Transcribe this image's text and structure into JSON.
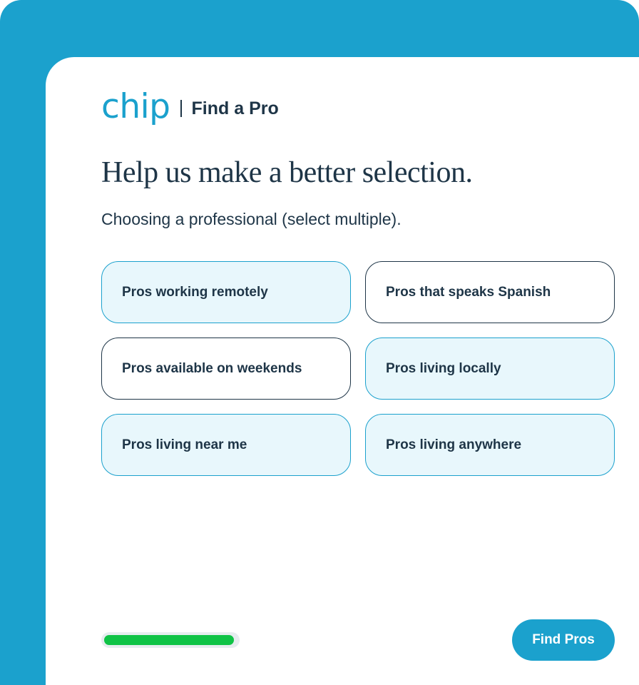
{
  "brand": {
    "logo_text": "chip",
    "title": "Find a Pro"
  },
  "question": {
    "heading": "Help us make a better selection.",
    "subheading": "Choosing a professional (select multiple)."
  },
  "options": [
    {
      "label": "Pros working remotely",
      "selected": true
    },
    {
      "label": "Pros that speaks Spanish",
      "selected": false
    },
    {
      "label": "Pros available on weekends",
      "selected": false
    },
    {
      "label": "Pros living locally",
      "selected": true
    },
    {
      "label": "Pros living near me",
      "selected": true
    },
    {
      "label": "Pros living anywhere",
      "selected": true
    }
  ],
  "progress": {
    "value": 0.98,
    "color": "#0fc346"
  },
  "footer": {
    "button_label": "Find Pros"
  },
  "colors": {
    "brand": "#1ba1cd",
    "text": "#1e3547",
    "selected_bg": "#e8f7fc"
  }
}
